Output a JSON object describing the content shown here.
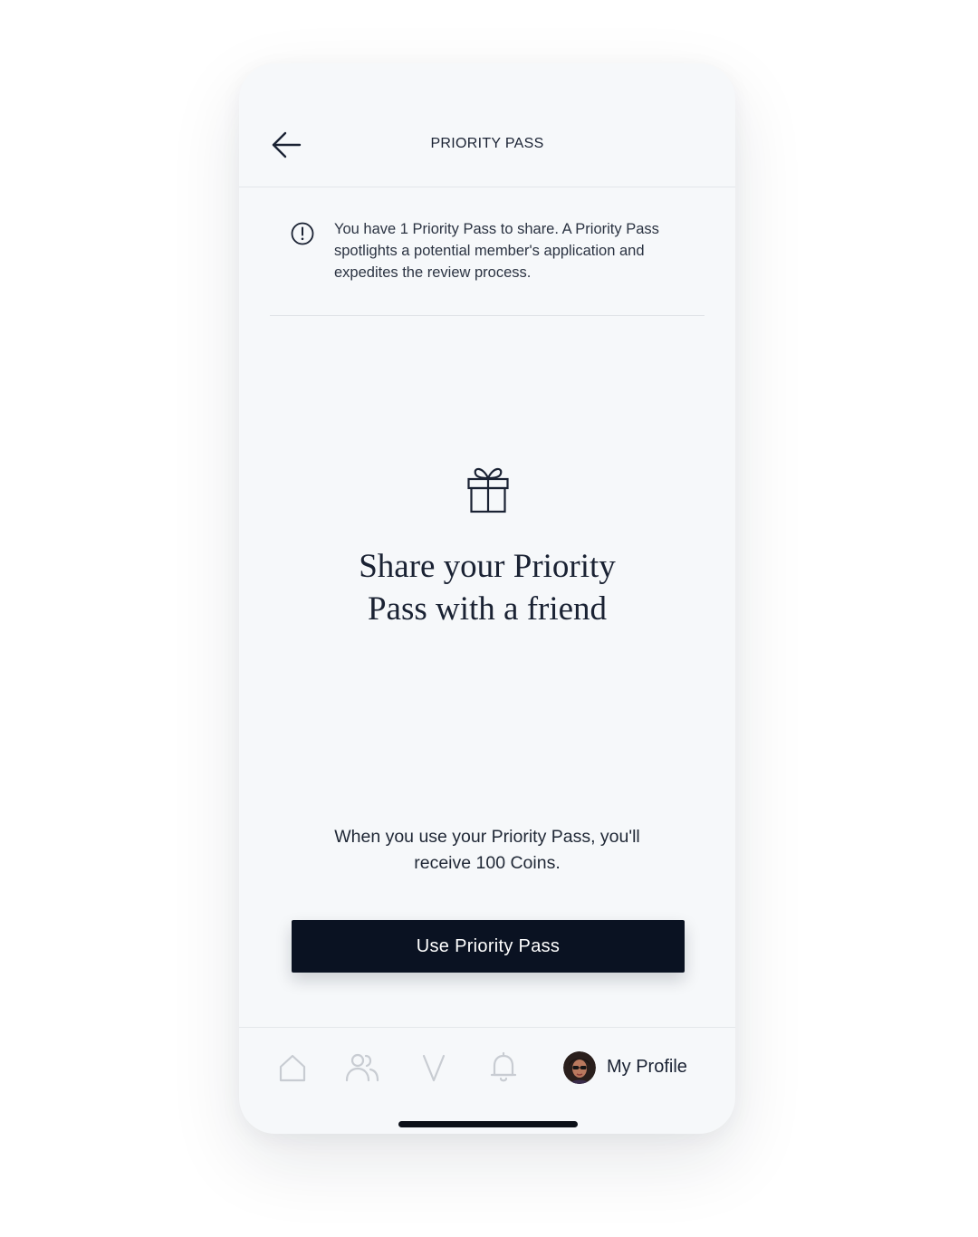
{
  "header": {
    "title": "PRIORITY PASS",
    "back_icon": "arrow-left-icon"
  },
  "notice": {
    "icon": "info-circle-icon",
    "text": "You have 1 Priority Pass to share. A Priority Pass spotlights a potential member's application and expedites the review process."
  },
  "main": {
    "icon": "gift-icon",
    "headline_line1": "Share your Priority",
    "headline_line2": "Pass with a friend",
    "reward_text": "When you use your Priority Pass, you'll receive 100 Coins.",
    "cta_label": "Use Priority Pass"
  },
  "tabbar": {
    "items": [
      {
        "icon": "home-icon"
      },
      {
        "icon": "people-icon"
      },
      {
        "icon": "v-logo-icon"
      },
      {
        "icon": "bell-icon"
      }
    ],
    "profile_label": "My Profile",
    "inactive_color": "#c8ccd2",
    "active_color": "#1a2233"
  },
  "colors": {
    "background": "#f6f8fa",
    "primary_dark": "#0a1222",
    "text": "#1a2233"
  }
}
